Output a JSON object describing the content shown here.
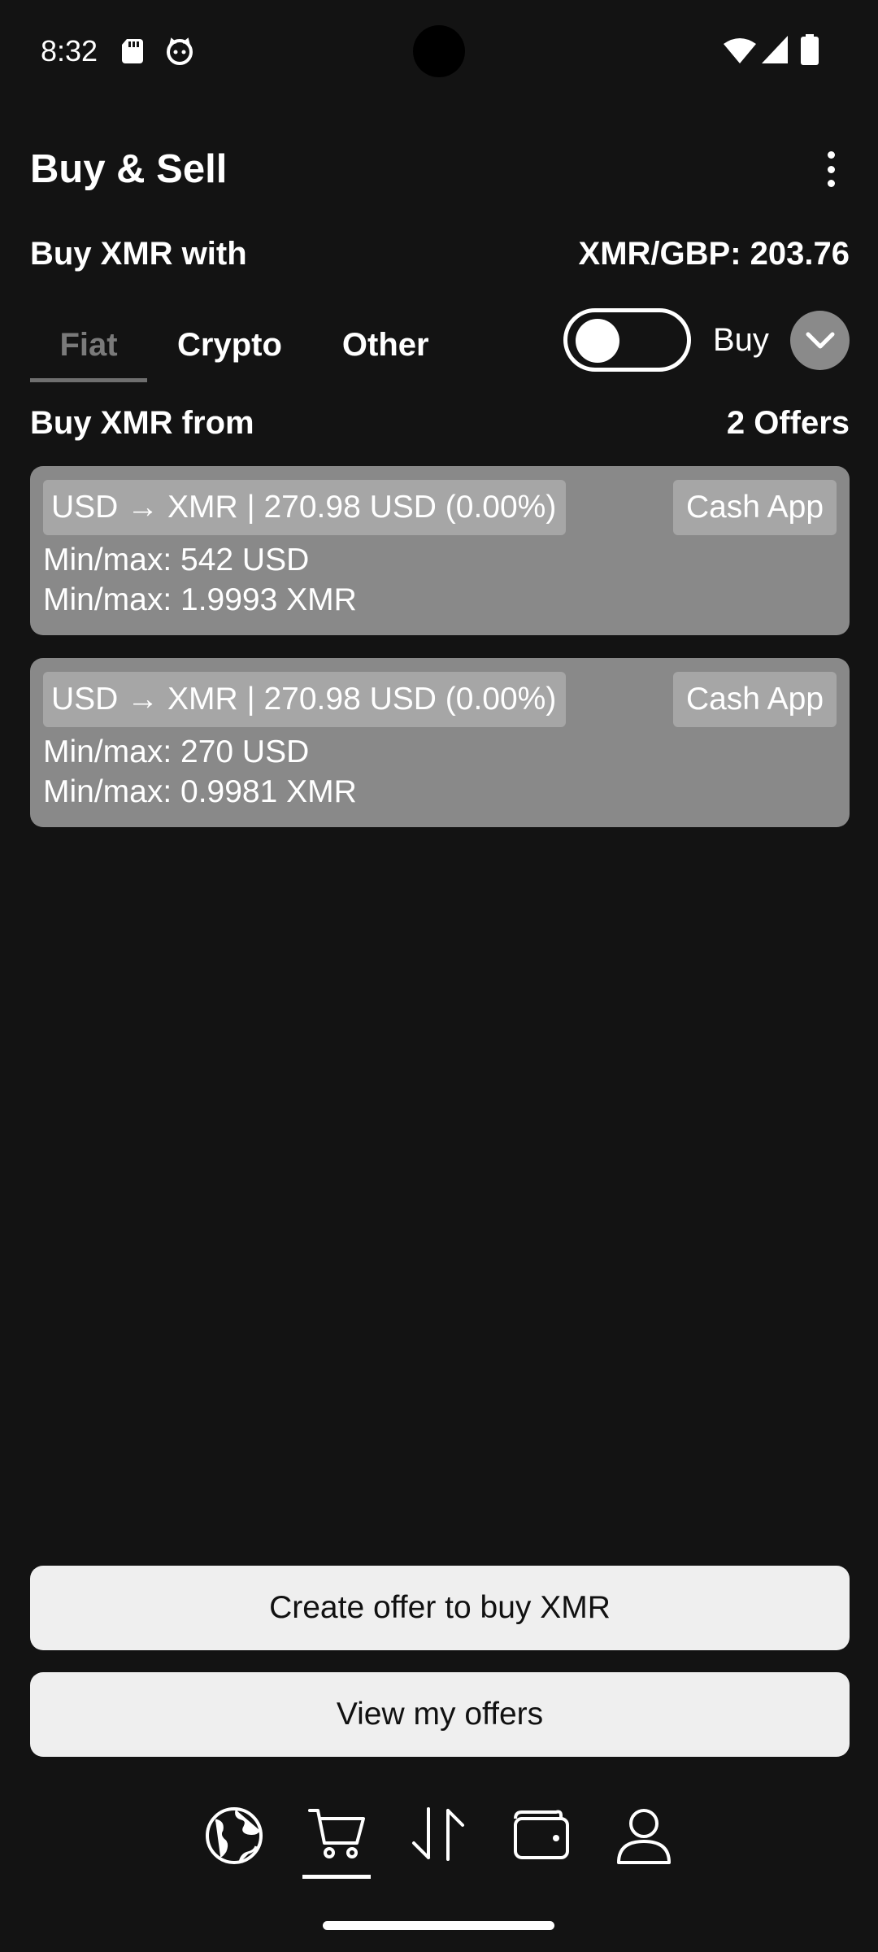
{
  "status_bar": {
    "time": "8:32"
  },
  "header": {
    "title": "Buy & Sell",
    "menu_icon": "more-vert-icon"
  },
  "market": {
    "buy_with_label": "Buy XMR with",
    "rate_label": "XMR/GBP: 203.76"
  },
  "tabs": [
    {
      "label": "Fiat",
      "active": true
    },
    {
      "label": "Crypto",
      "active": false
    },
    {
      "label": "Other",
      "active": false
    }
  ],
  "toggle": {
    "label": "Buy",
    "on": false
  },
  "offers_section": {
    "title": "Buy XMR from",
    "count_label": "2 Offers"
  },
  "offers": [
    {
      "pair": "USD → XMR | 270.98 USD (0.00%)",
      "method": "Cash App",
      "min_max_fiat": "Min/max: 542 USD",
      "min_max_xmr": "Min/max: 1.9993 XMR"
    },
    {
      "pair": "USD → XMR | 270.98 USD (0.00%)",
      "method": "Cash App",
      "min_max_fiat": "Min/max: 270 USD",
      "min_max_xmr": "Min/max: 0.9981 XMR"
    }
  ],
  "actions": {
    "create_offer": "Create offer to buy XMR",
    "view_offers": "View my offers"
  },
  "bottom_nav": [
    {
      "icon": "globe-icon",
      "active": false
    },
    {
      "icon": "cart-icon",
      "active": true
    },
    {
      "icon": "swap-arrows-icon",
      "active": false
    },
    {
      "icon": "wallet-icon",
      "active": false
    },
    {
      "icon": "person-icon",
      "active": false
    }
  ],
  "colors": {
    "background": "#131313",
    "card": "#898989",
    "chip": "#a6a6a6",
    "button": "#efefef"
  }
}
